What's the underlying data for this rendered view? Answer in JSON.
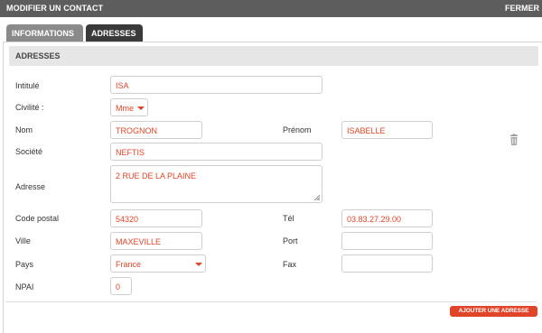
{
  "window": {
    "title": "MODIFIER UN CONTACT",
    "close_label": "FERMER"
  },
  "tabs": [
    {
      "label": "INFORMATIONS",
      "active": false
    },
    {
      "label": "ADRESSES",
      "active": true
    }
  ],
  "section": {
    "title": "ADRESSES"
  },
  "form": {
    "intitule": {
      "label": "Intitulé",
      "value": "ISA"
    },
    "civilite": {
      "label": "Civilité :",
      "value": "Mme"
    },
    "nom": {
      "label": "Nom",
      "value": "TROGNON"
    },
    "prenom": {
      "label": "Prénom",
      "value": "ISABELLE"
    },
    "societe": {
      "label": "Société",
      "value": "NEFTIS"
    },
    "adresse": {
      "label": "Adresse",
      "value": "2 RUE DE LA PLAINE"
    },
    "code_postal": {
      "label": "Code postal",
      "value": "54320"
    },
    "tel": {
      "label": "Tél",
      "value": "03.83.27.29.00"
    },
    "ville": {
      "label": "Ville",
      "value": "MAXEVILLE"
    },
    "port": {
      "label": "Port",
      "value": ""
    },
    "pays": {
      "label": "Pays",
      "value": "France"
    },
    "fax": {
      "label": "Fax",
      "value": ""
    },
    "npai": {
      "label": "NPAI",
      "value": "0"
    }
  },
  "actions": {
    "add_address_label": "AJOUTER UNE ADRESSE"
  },
  "colors": {
    "accent": "#e0452a",
    "titlebar": "#5d5d5d",
    "tab_active": "#3a3a3a",
    "tab_inactive": "#8a8a8a"
  },
  "icons": {
    "delete": "trash-icon",
    "dropdown": "caret-down-icon"
  }
}
